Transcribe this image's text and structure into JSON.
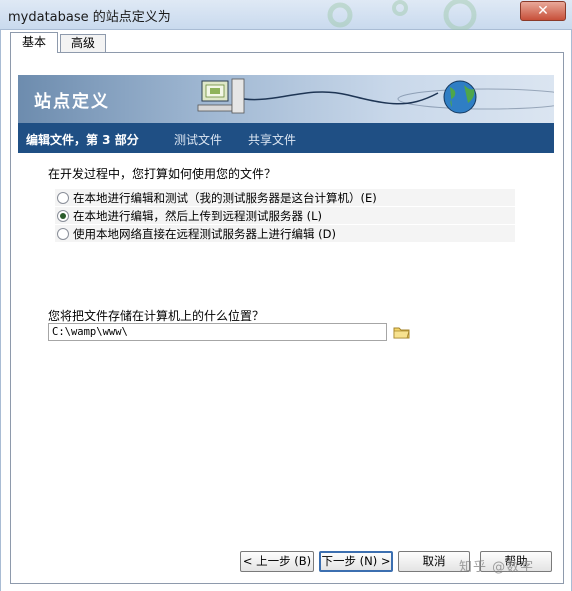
{
  "window": {
    "title": "mydatabase 的站点定义为",
    "close_label": "✕"
  },
  "tabs": [
    {
      "label": "基本",
      "active": true
    },
    {
      "label": "高级",
      "active": false
    }
  ],
  "banner": {
    "title": "站点定义"
  },
  "steps": {
    "current": "编辑文件，第 3 部分",
    "test": "测试文件",
    "share": "共享文件"
  },
  "question": "在开发过程中，您打算如何使用您的文件？",
  "options": [
    {
      "label": "在本地进行编辑和测试（我的测试服务器是这台计算机）(E)",
      "selected": false
    },
    {
      "label": "在本地进行编辑，然后上传到远程测试服务器 (L)",
      "selected": true
    },
    {
      "label": "使用本地网络直接在远程测试服务器上进行编辑 (D)",
      "selected": false
    }
  ],
  "location_question": "您将把文件存储在计算机上的什么位置？",
  "path_value": "C:\\wamp\\www\\",
  "buttons": {
    "back": "< 上一步 (B)",
    "next": "下一步 (N) >",
    "cancel": "取消",
    "help": "帮助"
  },
  "watermark": "知乎 @数字"
}
